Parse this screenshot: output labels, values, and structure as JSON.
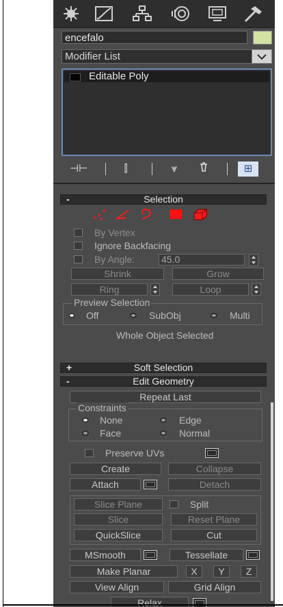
{
  "object_name": "encefalo",
  "modifier_list_label": "Modifier List",
  "modifier_stack": [
    "Editable Poly"
  ],
  "stack_tools": {
    "pin": "⊣⊢",
    "show_end": "⫿",
    "funnel": "⩔",
    "configure": "⊞"
  },
  "selection": {
    "header": "Selection",
    "collapse": "-",
    "by_vertex": "By Vertex",
    "ignore_backfacing": "Ignore Backfacing",
    "by_angle": "By Angle:",
    "angle_value": "45.0",
    "shrink": "Shrink",
    "grow": "Grow",
    "ring": "Ring",
    "loop": "Loop",
    "preview_group": "Preview Selection",
    "preview_off": "Off",
    "preview_subobj": "SubObj",
    "preview_multi": "Multi",
    "status": "Whole Object Selected"
  },
  "soft_selection": {
    "header": "Soft Selection",
    "toggle": "+"
  },
  "edit_geometry": {
    "header": "Edit Geometry",
    "collapse": "-",
    "repeat_last": "Repeat Last",
    "constraints_group": "Constraints",
    "c_none": "None",
    "c_edge": "Edge",
    "c_face": "Face",
    "c_normal": "Normal",
    "preserve_uvs": "Preserve UVs",
    "create": "Create",
    "collapse_btn": "Collapse",
    "attach": "Attach",
    "detach": "Detach",
    "slice_plane": "Slice Plane",
    "split": "Split",
    "slice": "Slice",
    "reset_plane": "Reset Plane",
    "quickslice": "QuickSlice",
    "cut": "Cut",
    "msmooth": "MSmooth",
    "tessellate": "Tessellate",
    "make_planar": "Make Planar",
    "x": "X",
    "y": "Y",
    "z": "Z",
    "view_align": "View Align",
    "grid_align": "Grid Align",
    "relax": "Relax"
  },
  "colors": {
    "panel": "#4b4b4b",
    "accent_red": "#ff1010",
    "swatch": "#d2e2a4"
  }
}
